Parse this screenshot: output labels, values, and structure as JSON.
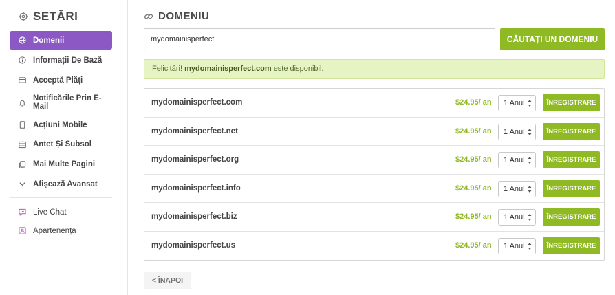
{
  "sidebar": {
    "title": "SETĂRI",
    "items": [
      {
        "label": "Domenii",
        "icon": "globe-icon"
      },
      {
        "label": "Informații De Bază",
        "icon": "info-icon"
      },
      {
        "label": "Acceptă Plăți",
        "icon": "card-icon"
      },
      {
        "label": "Notificările Prin E-Mail",
        "icon": "bell-icon"
      },
      {
        "label": "Acțiuni Mobile",
        "icon": "mobile-icon"
      },
      {
        "label": "Antet Și Subsol",
        "icon": "layout-icon"
      },
      {
        "label": "Mai Multe Pagini",
        "icon": "pages-icon"
      },
      {
        "label": "Afișează Avansat",
        "icon": "chevron-down-icon"
      }
    ],
    "extra_items": [
      {
        "label": "Live Chat",
        "icon": "chat-icon"
      },
      {
        "label": "Apartenența",
        "icon": "member-icon"
      }
    ]
  },
  "main": {
    "title": "DOMENIU",
    "search_value": "mydomainisperfect",
    "search_button": "CĂUTAȚI UN DOMENIU",
    "alert": {
      "prefix": "Felicitări!",
      "domain": "mydomainisperfect.com",
      "suffix": "este disponibil."
    },
    "results": [
      {
        "domain": "mydomainisperfect.com",
        "price": "$24.95/ an",
        "period": "1 Anul",
        "action": "ÎNREGISTRARE"
      },
      {
        "domain": "mydomainisperfect.net",
        "price": "$24.95/ an",
        "period": "1 Anul",
        "action": "ÎNREGISTRARE"
      },
      {
        "domain": "mydomainisperfect.org",
        "price": "$24.95/ an",
        "period": "1 Anul",
        "action": "ÎNREGISTRARE"
      },
      {
        "domain": "mydomainisperfect.info",
        "price": "$24.95/ an",
        "period": "1 Anul",
        "action": "ÎNREGISTRARE"
      },
      {
        "domain": "mydomainisperfect.biz",
        "price": "$24.95/ an",
        "period": "1 Anul",
        "action": "ÎNREGISTRARE"
      },
      {
        "domain": "mydomainisperfect.us",
        "price": "$24.95/ an",
        "period": "1 Anul",
        "action": "ÎNREGISTRARE"
      }
    ],
    "back_button": "< ÎNAPOI"
  },
  "colors": {
    "accent_purple": "#8c59c4",
    "accent_green": "#8fba24",
    "alert_bg": "#e6f4c4",
    "pink_icon": "#c44ec4"
  }
}
